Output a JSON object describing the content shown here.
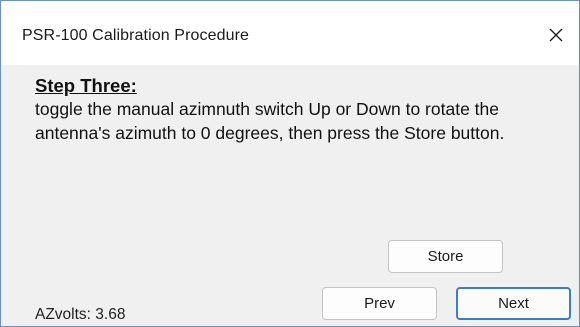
{
  "window": {
    "title": "PSR-100 Calibration Procedure",
    "close_icon": "close-x-icon"
  },
  "step": {
    "heading": "Step Three:",
    "body": "toggle the manual azimnuth switch Up or Down to rotate the antenna's azimuth to 0 degrees, then press the Store button."
  },
  "buttons": {
    "store_label": "Store",
    "prev_label": "Prev",
    "next_label": "Next"
  },
  "status": {
    "azvolts": "AZvolts: 3.68"
  },
  "colors": {
    "window_border": "#6e8fc4",
    "default_button_border": "#3b7cd1",
    "content_background": "#f0f0f0"
  }
}
